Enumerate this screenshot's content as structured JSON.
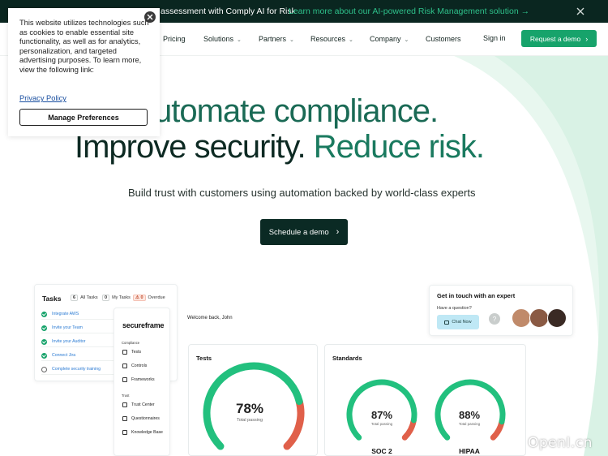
{
  "announcement": {
    "lead": "assessment with Comply AI for Risk",
    "learn_more": "Learn more about our AI-powered Risk Management solution →"
  },
  "nav": {
    "items": [
      {
        "label": "Pricing",
        "caret": false
      },
      {
        "label": "Solutions",
        "caret": true
      },
      {
        "label": "Partners",
        "caret": true
      },
      {
        "label": "Resources",
        "caret": true
      },
      {
        "label": "Company",
        "caret": true
      },
      {
        "label": "Customers",
        "caret": false
      }
    ],
    "sign_in": "Sign in",
    "request_demo": "Request a demo"
  },
  "hero": {
    "line1": "utomate compliance.",
    "line2_dark": "Improve security.",
    "line2_green": "Reduce risk.",
    "subtitle": "Build trust with customers using automation backed by world-class experts",
    "cta": "Schedule a demo"
  },
  "cookie": {
    "text": "This website utilizes technologies such as cookies to enable essential site functionality, as well as for analytics, personalization, and targeted advertising purposes. To learn more, view the following link:",
    "privacy_link": "Privacy Policy",
    "manage_button": "Manage Preferences"
  },
  "tasks": {
    "title": "Tasks",
    "filters": [
      {
        "count": "6",
        "label": "All Tasks",
        "alert": false
      },
      {
        "count": "0",
        "label": "My Tasks",
        "alert": false
      },
      {
        "count": "0",
        "label": "Overdue",
        "alert": true
      }
    ],
    "items": [
      {
        "label": "Integrate AWS",
        "done": true
      },
      {
        "label": "Invite your Team",
        "done": true
      },
      {
        "label": "Invite your Auditor",
        "done": true
      },
      {
        "label": "Connect Jira",
        "done": true
      },
      {
        "label": "Complete security training",
        "done": false
      }
    ]
  },
  "sidebar": {
    "logo": "secureframe",
    "compliance_heading": "Compliance",
    "compliance_items": [
      "Tests",
      "Controls",
      "Frameworks"
    ],
    "trust_heading": "Trust",
    "trust_items": [
      "Trust Center",
      "Questionnaires",
      "Knowledge Base"
    ]
  },
  "dashboard": {
    "welcome": "Welcome back, John",
    "tests_title": "Tests",
    "tests_percent": "78%",
    "tests_value": 0.78,
    "tests_caption": "Total passing",
    "standards_title": "Standards",
    "standards": [
      {
        "name": "SOC 2",
        "percent": "87%",
        "value": 0.87,
        "caption": "Total passing"
      },
      {
        "name": "HIPAA",
        "percent": "88%",
        "value": 0.88,
        "caption": "Total passing"
      }
    ]
  },
  "contact": {
    "title": "Get in touch with an expert",
    "question": "Have a question?",
    "chat_button": "Chat Now"
  },
  "colors": {
    "brand_green": "#17a36b",
    "dark_green": "#0a2620",
    "gauge_green": "#22c07e",
    "gauge_red": "#e0604a"
  },
  "watermark": "OpenI.cn"
}
